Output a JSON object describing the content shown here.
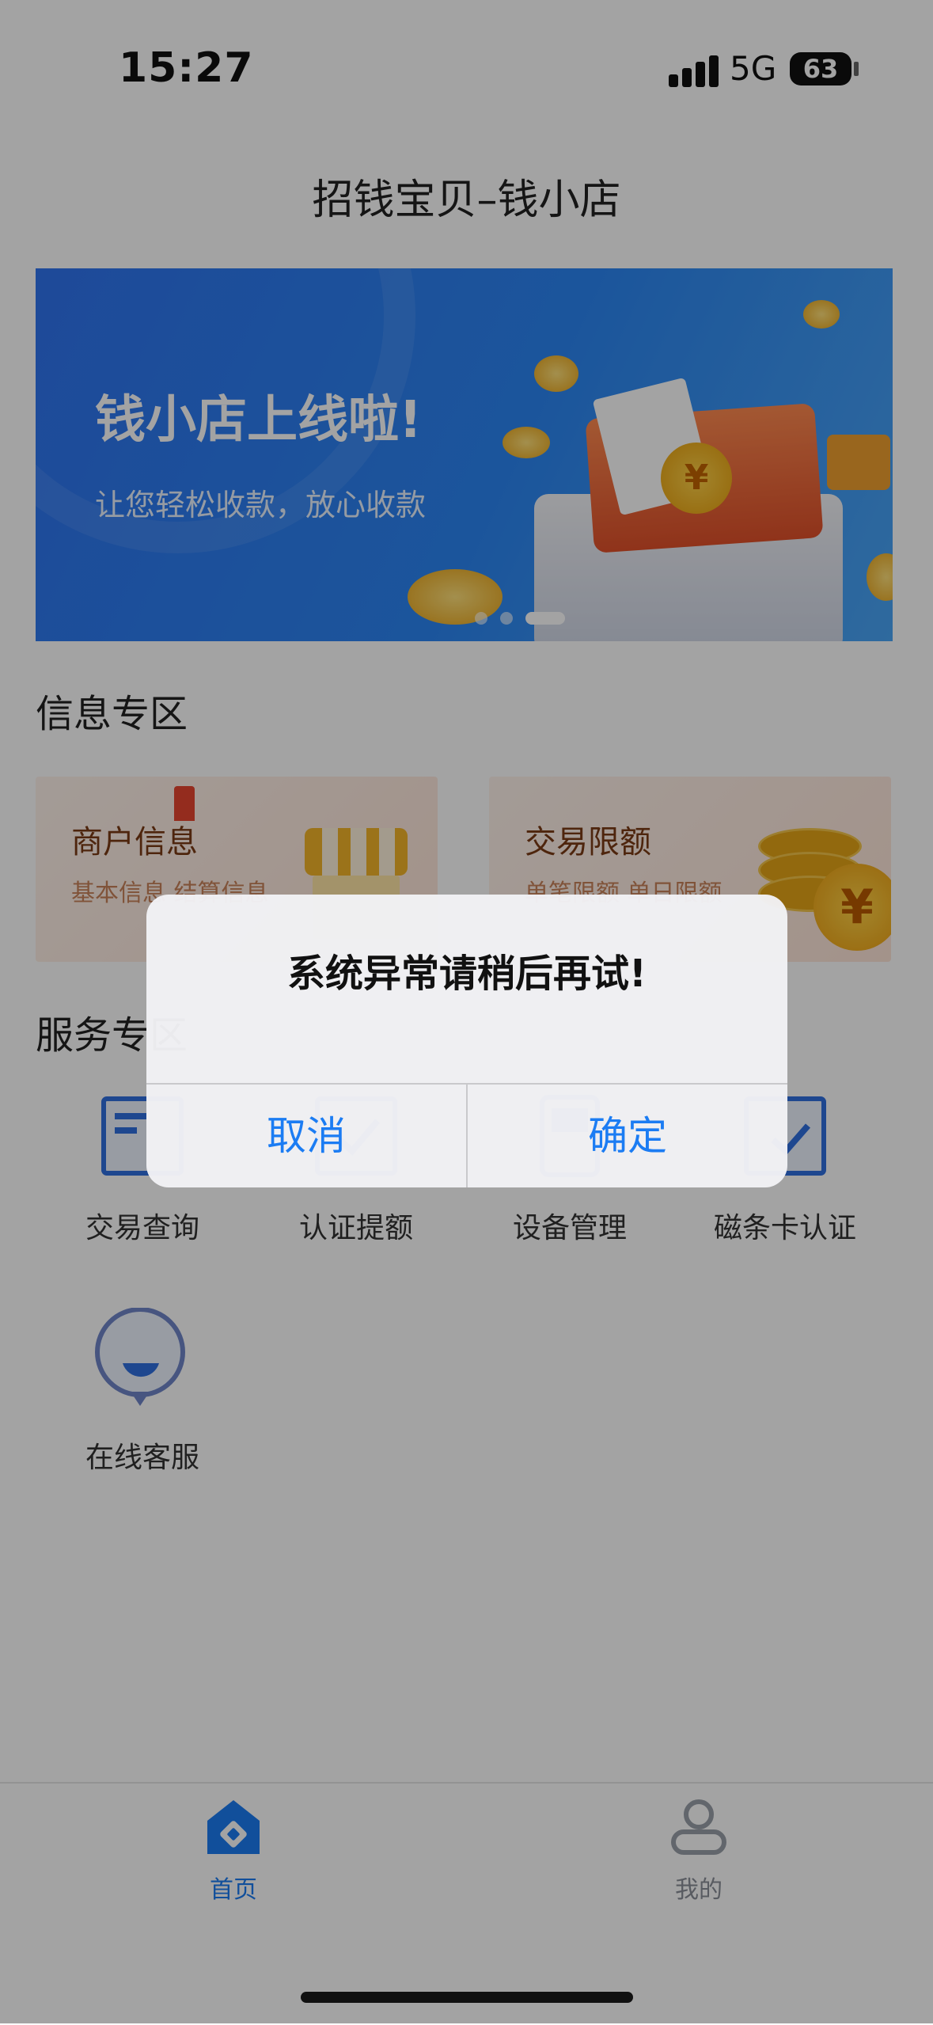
{
  "status_bar": {
    "time": "15:27",
    "network": "5G",
    "battery": "63"
  },
  "page": {
    "title": "招钱宝贝–钱小店"
  },
  "banner": {
    "headline": "钱小店上线啦!",
    "subline": "让您轻松收款，放心收款",
    "page_dots": 3,
    "active_dot": 3
  },
  "info_section": {
    "title": "信息专区",
    "cards": [
      {
        "title": "商户信息",
        "subtitle": "基本信息 结算信息"
      },
      {
        "title": "交易限额",
        "subtitle": "单笔限额 单日限额"
      }
    ]
  },
  "service_section": {
    "title": "服务专区",
    "items": [
      {
        "label": "交易查询",
        "icon": "transaction-query-icon"
      },
      {
        "label": "认证提额",
        "icon": "verify-limit-icon"
      },
      {
        "label": "设备管理",
        "icon": "device-management-icon"
      },
      {
        "label": "磁条卡认证",
        "icon": "magstripe-card-icon"
      },
      {
        "label": "在线客服",
        "icon": "chat-support-icon"
      }
    ]
  },
  "tab_bar": {
    "tabs": [
      {
        "label": "首页",
        "icon": "home-icon",
        "active": true
      },
      {
        "label": "我的",
        "icon": "profile-icon",
        "active": false
      }
    ]
  },
  "dialog": {
    "message": "系统异常请稍后再试!",
    "cancel_label": "取消",
    "confirm_label": "确定"
  },
  "colors": {
    "accent": "#1b7cf3",
    "banner_blue": "#2b86f4",
    "card_title": "#7a3a15",
    "scrim": "rgba(0,0,0,0.36)"
  }
}
